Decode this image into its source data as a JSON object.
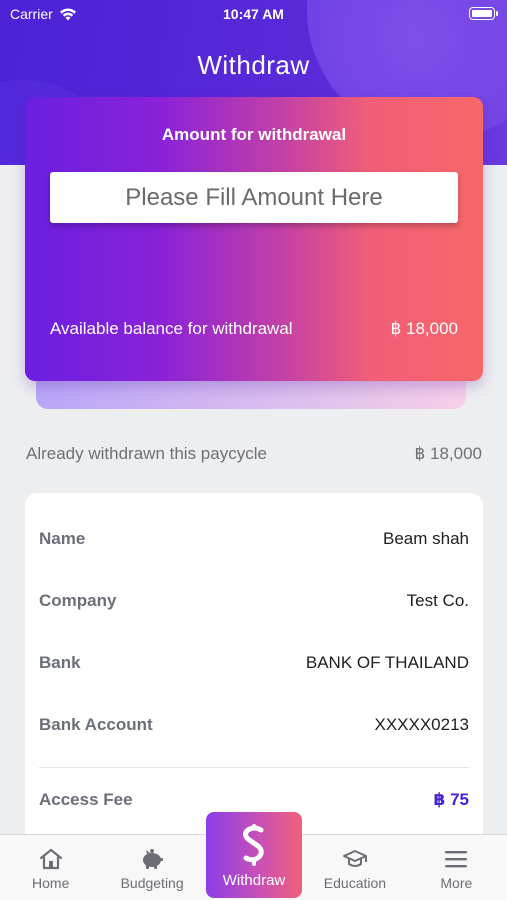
{
  "status_bar": {
    "carrier": "Carrier",
    "time": "10:47 AM"
  },
  "header": {
    "title": "Withdraw"
  },
  "withdraw_card": {
    "title": "Amount for withdrawal",
    "amount_placeholder": "Please Fill Amount Here",
    "amount_value": "",
    "balance_label": "Available balance for withdrawal",
    "balance_value": "฿ 18,000"
  },
  "already_withdrawn": {
    "label": "Already withdrawn this paycycle",
    "value": "฿ 18,000"
  },
  "details": {
    "name_label": "Name",
    "name_value": "Beam shah",
    "company_label": "Company",
    "company_value": "Test Co.",
    "bank_label": "Bank",
    "bank_value": "BANK OF THAILAND",
    "account_label": "Bank Account",
    "account_value": "XXXXX0213",
    "fee_label": "Access Fee",
    "fee_value": "฿ 75"
  },
  "tab_bar": {
    "home": "Home",
    "budgeting": "Budgeting",
    "withdraw": "Withdraw",
    "education": "Education",
    "more": "More",
    "active": "withdraw"
  },
  "colors": {
    "brand_purple": "#4a22d6",
    "accent_coral": "#f66868",
    "fee_color": "#4a22d6"
  }
}
